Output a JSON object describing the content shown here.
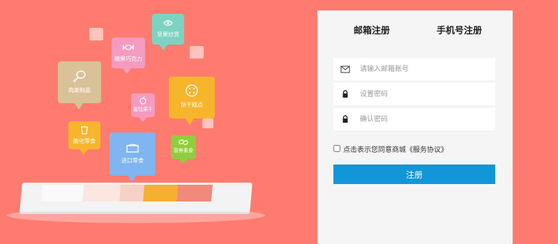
{
  "illustration": {
    "bubbles": [
      {
        "key": "nuts",
        "label": "坚果炒货",
        "color": "#7dd3c2",
        "icon": "bowl-icon"
      },
      {
        "key": "chocolate",
        "label": "糖果巧克力",
        "color": "#f49bc1",
        "icon": "candy-icon"
      },
      {
        "key": "meat",
        "label": "肉类制品",
        "color": "#d9c198",
        "icon": "drumstick-icon"
      },
      {
        "key": "dried_fruit",
        "label": "蜜饯果干",
        "color": "#f49bc1",
        "icon": "fruit-icon"
      },
      {
        "key": "biscuits",
        "label": "饼干糕点",
        "color": "#f7b52c",
        "icon": "biscuit-icon"
      },
      {
        "key": "puffed",
        "label": "膨化零食",
        "color": "#f7b52c",
        "icon": "cup-icon"
      },
      {
        "key": "imported",
        "label": "进口零食",
        "color": "#7fb5f0",
        "icon": "ticket-icon"
      },
      {
        "key": "healthy",
        "label": "营养素食",
        "color": "#8fce3e",
        "icon": "link-icon"
      }
    ]
  },
  "register": {
    "tabs": {
      "email": "邮箱注册",
      "phone": "手机号注册"
    },
    "fields": {
      "email": {
        "placeholder": "请输入邮箱账号",
        "value": ""
      },
      "password": {
        "placeholder": "设置密码",
        "value": ""
      },
      "confirm": {
        "placeholder": "确认密码",
        "value": ""
      }
    },
    "agreement": "点击表示您同意商城《服务协议》",
    "agreement_checked": false,
    "submit_label": "注册",
    "accent_color": "#1296d8"
  }
}
